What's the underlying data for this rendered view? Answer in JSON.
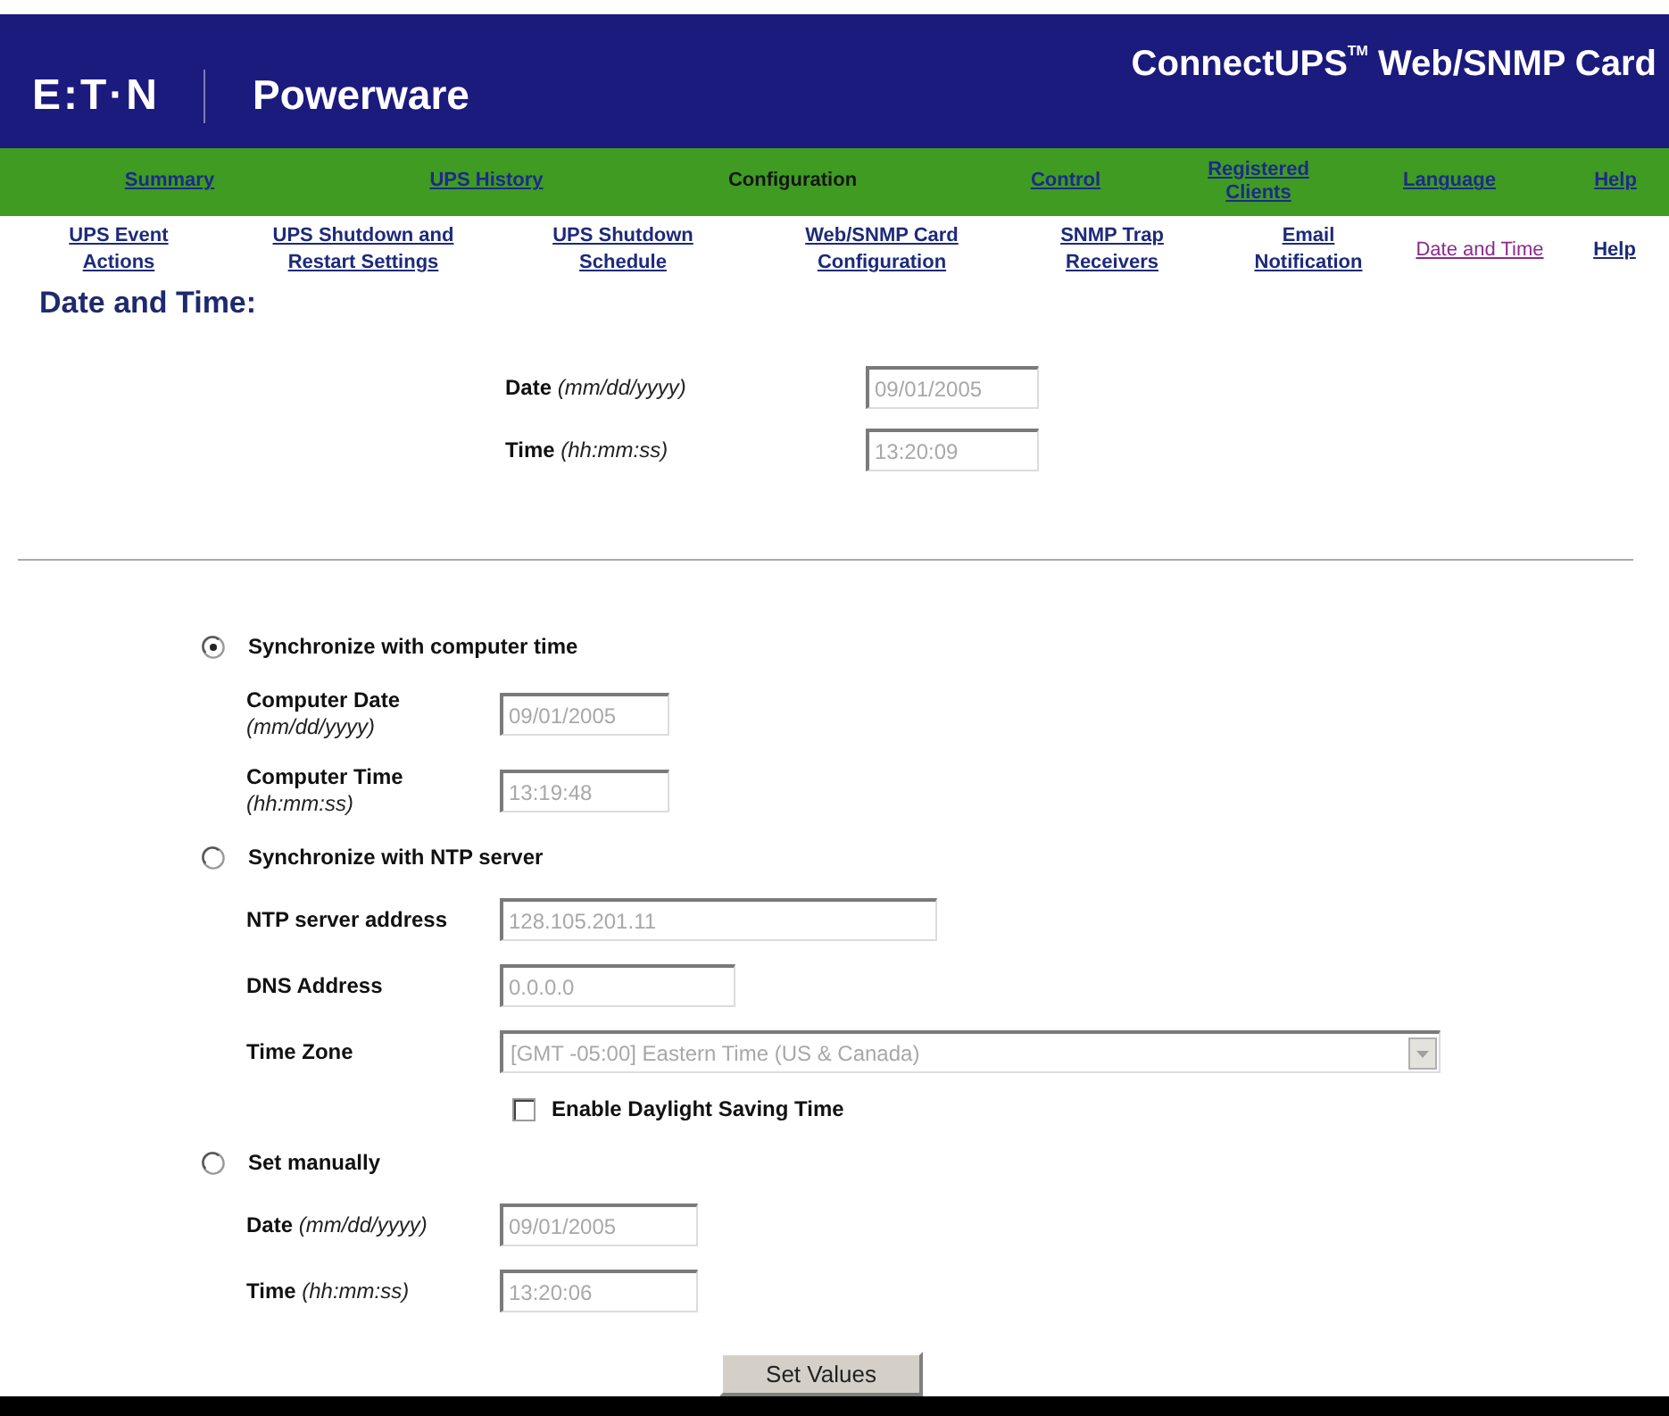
{
  "header": {
    "logo": "E:T·N",
    "brand": "Powerware",
    "title": "ConnectUPS$^{TM}$ Web/SNMP Card"
  },
  "main_nav": [
    {
      "label": "Summary",
      "selected": false
    },
    {
      "label": "UPS History",
      "selected": false
    },
    {
      "label": "Configuration",
      "selected": true
    },
    {
      "label": "Control",
      "selected": false
    },
    {
      "label": "Registered Clients",
      "selected": false
    },
    {
      "label": "Language",
      "selected": false
    },
    {
      "label": "Help",
      "selected": false
    }
  ],
  "sub_nav": [
    {
      "label": "UPS Event Actions",
      "selected": false
    },
    {
      "label": "UPS Shutdown and Restart Settings",
      "selected": false
    },
    {
      "label": "UPS Shutdown Schedule",
      "selected": false
    },
    {
      "label": "Web/SNMP Card Configuration",
      "selected": false
    },
    {
      "label": "SNMP Trap Receivers",
      "selected": false
    },
    {
      "label": "Email Notification",
      "selected": false
    },
    {
      "label": "Date and Time",
      "selected": true
    },
    {
      "label": "Help",
      "selected": false
    }
  ],
  "page_title": "Date and Time:",
  "current": {
    "fields": [
      {
        "kind": "text",
        "label": "Date *(mm/dd/yyyy)*",
        "value": "09/01/2005",
        "disabled": true
      },
      {
        "kind": "text",
        "label": "Time *(hh:mm:ss)*",
        "value": "13:20:09",
        "disabled": true
      }
    ]
  },
  "sync_options": [
    {
      "label": "Synchronize with computer time",
      "selected": true,
      "fields": [
        {
          "kind": "text",
          "label": "Computer Date *(mm/dd/yyyy)*",
          "value": "09/01/2005",
          "disabled": true
        },
        {
          "kind": "text",
          "label": "Computer Time *(hh:mm:ss)*",
          "value": "13:19:48",
          "disabled": true
        }
      ]
    },
    {
      "label": "Synchronize with NTP server",
      "selected": false,
      "fields": [
        {
          "kind": "text",
          "label": "NTP server address",
          "value": "128.105.201.11",
          "disabled": true
        },
        {
          "kind": "text",
          "label": "DNS Address",
          "value": "0.0.0.0",
          "disabled": true
        },
        {
          "kind": "select",
          "label": "Time Zone",
          "value": "[GMT -05:00] Eastern Time (US & Canada)",
          "disabled": true
        },
        {
          "kind": "checkbox",
          "label": "Enable Daylight Saving Time",
          "checked": false
        }
      ]
    },
    {
      "label": "Set manually",
      "selected": false,
      "fields": [
        {
          "kind": "text",
          "label": "Date *(mm/dd/yyyy)*",
          "value": "09/01/2005",
          "disabled": true
        },
        {
          "kind": "text",
          "label": "Time *(hh:mm:ss)*",
          "value": "13:20:06",
          "disabled": true
        }
      ]
    }
  ],
  "button": "Set Values"
}
